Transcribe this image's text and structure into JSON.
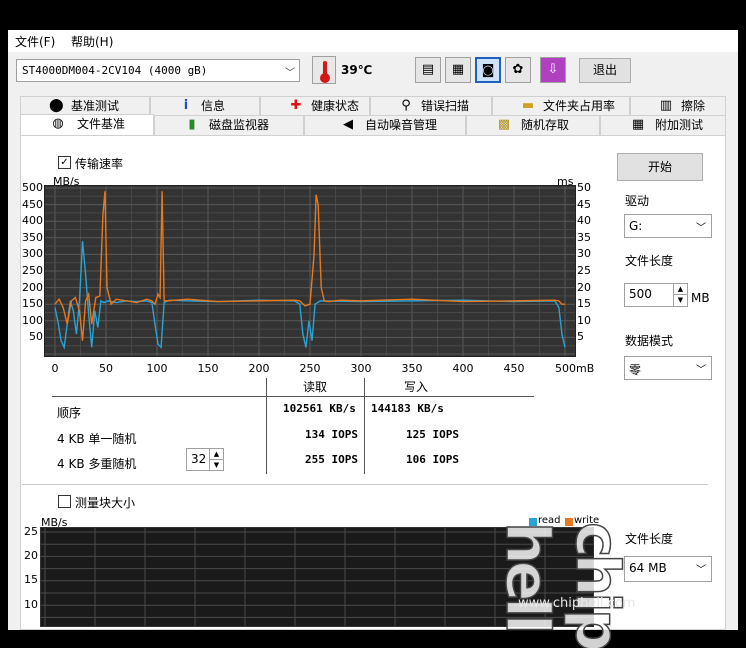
{
  "menu": {
    "file": "文件(F)",
    "help": "帮助(H)"
  },
  "toolbar": {
    "drive_select": "ST4000DM004-2CV104 (4000 gB)",
    "temperature": "39℃",
    "exit_label": "退出",
    "icons": [
      "copy-text-icon",
      "copy-info-icon",
      "camera-icon",
      "gear-icon",
      "download-arrow-icon"
    ]
  },
  "tabs_row1": [
    {
      "label": "基准测试",
      "icon": "benchmark-icon"
    },
    {
      "label": "信息",
      "icon": "info-icon"
    },
    {
      "label": "健康状态",
      "icon": "health-cross-icon"
    },
    {
      "label": "错误扫描",
      "icon": "magnifier-icon"
    },
    {
      "label": "文件夹占用率",
      "icon": "folder-icon"
    },
    {
      "label": "擦除",
      "icon": "trash-icon"
    }
  ],
  "tabs_row2": [
    {
      "label": "文件基准",
      "icon": "file-benchmark-icon",
      "selected": true
    },
    {
      "label": "磁盘监视器",
      "icon": "disk-monitor-icon"
    },
    {
      "label": "自动噪音管理",
      "icon": "speaker-icon"
    },
    {
      "label": "随机存取",
      "icon": "random-access-icon"
    },
    {
      "label": "附加测试",
      "icon": "extra-tests-icon"
    }
  ],
  "transfer_rate_label": "传输速率",
  "start_label": "开始",
  "drive_label": "驱动",
  "drive_value": "G:",
  "file_length_label": "文件长度",
  "file_length_value": "500",
  "file_length_unit": "MB",
  "data_mode_label": "数据模式",
  "data_mode_value": "零",
  "chart_data": {
    "type": "line",
    "left_unit": "MB/s",
    "right_unit": "ms",
    "x_unit": "mB",
    "y_ticks": [
      "500",
      "450",
      "400",
      "350",
      "300",
      "250",
      "200",
      "150",
      "100",
      "50"
    ],
    "y2_ticks": [
      "50",
      "45",
      "40",
      "35",
      "30",
      "25",
      "20",
      "15",
      "10",
      "5"
    ],
    "x_ticks": [
      "0",
      "50",
      "100",
      "150",
      "200",
      "250",
      "300",
      "350",
      "400",
      "450",
      "500mB"
    ],
    "xlim": [
      0,
      500
    ],
    "ylim": [
      0,
      500
    ],
    "colors": {
      "read": "#29a3d6",
      "write": "#e8781e"
    },
    "series": [
      {
        "name": "read",
        "x": [
          0,
          3,
          6,
          9,
          12,
          15,
          18,
          21,
          24,
          27,
          30,
          33,
          36,
          39,
          42,
          45,
          48,
          52,
          60,
          70,
          80,
          90,
          95,
          98,
          101,
          104,
          107,
          112,
          130,
          160,
          200,
          235,
          240,
          243,
          246,
          249,
          252,
          255,
          260,
          300,
          350,
          400,
          450,
          490,
          494,
          497,
          500
        ],
        "y": [
          140,
          95,
          40,
          20,
          90,
          160,
          130,
          60,
          160,
          340,
          240,
          120,
          20,
          130,
          80,
          160,
          155,
          160,
          155,
          160,
          158,
          160,
          155,
          90,
          30,
          20,
          155,
          162,
          160,
          158,
          162,
          160,
          150,
          60,
          20,
          100,
          40,
          150,
          160,
          158,
          160,
          162,
          158,
          160,
          140,
          60,
          20
        ]
      },
      {
        "name": "write",
        "x": [
          0,
          4,
          8,
          12,
          16,
          20,
          24,
          27,
          30,
          33,
          36,
          40,
          44,
          47,
          49,
          51,
          55,
          60,
          70,
          80,
          90,
          95,
          98,
          101,
          103,
          105,
          107,
          110,
          130,
          160,
          200,
          235,
          240,
          245,
          250,
          254,
          256,
          258,
          261,
          264,
          268,
          280,
          300,
          350,
          400,
          450,
          490,
          494,
          497,
          500
        ],
        "y": [
          150,
          165,
          140,
          90,
          160,
          170,
          130,
          40,
          160,
          180,
          90,
          170,
          175,
          420,
          490,
          200,
          150,
          165,
          160,
          155,
          165,
          160,
          150,
          180,
          170,
          490,
          160,
          160,
          165,
          158,
          160,
          162,
          160,
          145,
          150,
          300,
          480,
          450,
          200,
          160,
          158,
          162,
          160,
          165,
          158,
          160,
          162,
          160,
          150,
          150
        ]
      }
    ]
  },
  "results": {
    "read_header": "读取",
    "write_header": "写入",
    "rows": [
      {
        "label": "顺序",
        "read": "102561 KB/s",
        "write": "144183 KB/s"
      },
      {
        "label": "4 KB 单一随机",
        "read": "134 IOPS",
        "write": "125 IOPS"
      },
      {
        "label": "4 KB 多重随机",
        "read": "255 IOPS",
        "write": "106 IOPS"
      }
    ],
    "queue_depth": "32"
  },
  "block_size_label": "测量块大小",
  "chart2": {
    "unit": "MB/s",
    "y_ticks": [
      "25",
      "20",
      "15",
      "10"
    ],
    "legend_read": "read",
    "legend_write": "write"
  },
  "file_length2_label": "文件长度",
  "file_length2_value": "64 MB",
  "watermark": "www.chiphell.com",
  "logo_text": "chiphell"
}
